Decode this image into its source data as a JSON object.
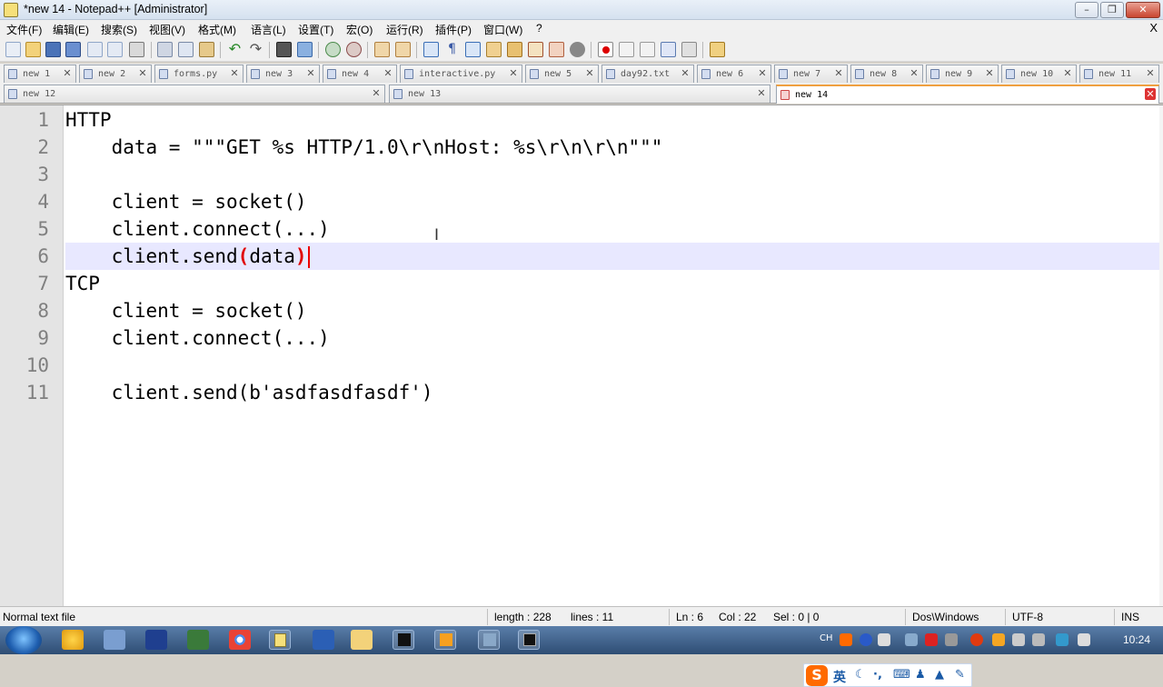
{
  "window": {
    "title": "*new 14 - Notepad++ [Administrator]"
  },
  "menu": {
    "items": [
      "文件(F)",
      "编辑(E)",
      "搜索(S)",
      "视图(V)",
      "格式(M)",
      "语言(L)",
      "设置(T)",
      "宏(O)",
      "运行(R)",
      "插件(P)",
      "窗口(W)",
      "?"
    ],
    "close": "X"
  },
  "tabs": {
    "row1": [
      "new 1",
      "new 2",
      "forms.py",
      "new 3",
      "new 4",
      "interactive.py",
      "new 5",
      "day92.txt",
      "new 6",
      "new 7",
      "new 8",
      "new 9",
      "new 10",
      "new 11"
    ],
    "row2": [
      "new 12",
      "new 13",
      "new 14"
    ],
    "active": "new 14",
    "close_glyph": "✕"
  },
  "editor": {
    "line_numbers": [
      "1",
      "2",
      "3",
      "4",
      "5",
      "6",
      "7",
      "8",
      "9",
      "10",
      "11"
    ],
    "lines": [
      "HTTP",
      "    data = \"\"\"GET %s HTTP/1.0\\r\\nHost: %s\\r\\n\\r\\n\"\"\"",
      "",
      "    client = socket()",
      "    client.connect(...)",
      "    client.send(data)",
      "TCP",
      "    client = socket()",
      "    client.connect(...)",
      "",
      "    client.send(b'asdfasdfasdf')"
    ],
    "current_line": 6,
    "cursor_glyph": "I"
  },
  "ime": {
    "logo": "S",
    "mode": "英"
  },
  "status": {
    "file_type": "Normal text file",
    "length": "length : 228",
    "lines": "lines : 11",
    "ln": "Ln : 6",
    "col": "Col : 22",
    "sel": "Sel : 0 | 0",
    "eol": "Dos\\Windows",
    "encoding": "UTF-8",
    "mode": "INS"
  },
  "taskbar": {
    "ime_indicator": "CH",
    "clock": "10:24"
  }
}
